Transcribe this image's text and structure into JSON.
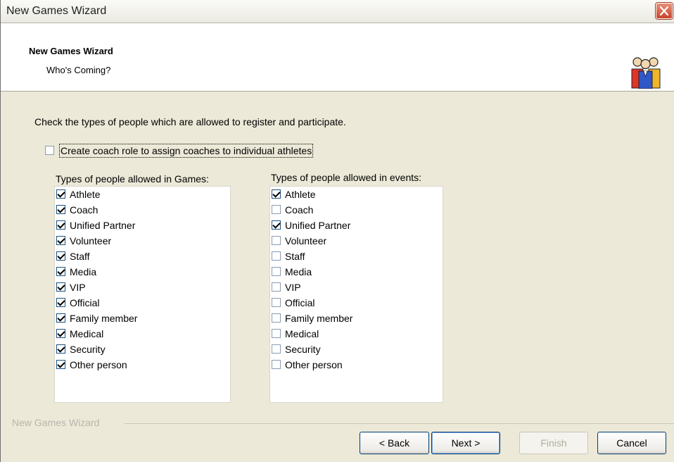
{
  "window": {
    "title": "New Games Wizard"
  },
  "header": {
    "title": "New Games Wizard",
    "subtitle": "Who's Coming?"
  },
  "instruction": "Check the types of people which are allowed to register and participate.",
  "coach_option": {
    "label": "Create coach role to assign coaches to individual athletes",
    "checked": false
  },
  "games_list": {
    "caption": "Types of people allowed in Games:",
    "items": [
      {
        "label": "Athlete",
        "checked": true
      },
      {
        "label": "Coach",
        "checked": true
      },
      {
        "label": "Unified Partner",
        "checked": true
      },
      {
        "label": "Volunteer",
        "checked": true
      },
      {
        "label": "Staff",
        "checked": true
      },
      {
        "label": "Media",
        "checked": true
      },
      {
        "label": "VIP",
        "checked": true
      },
      {
        "label": "Official",
        "checked": true
      },
      {
        "label": "Family member",
        "checked": true
      },
      {
        "label": "Medical",
        "checked": true
      },
      {
        "label": "Security",
        "checked": true
      },
      {
        "label": "Other person",
        "checked": true
      }
    ]
  },
  "events_list": {
    "caption": "Types of people allowed in events:",
    "items": [
      {
        "label": "Athlete",
        "checked": true
      },
      {
        "label": "Coach",
        "checked": false
      },
      {
        "label": "Unified Partner",
        "checked": true
      },
      {
        "label": "Volunteer",
        "checked": false
      },
      {
        "label": "Staff",
        "checked": false
      },
      {
        "label": "Media",
        "checked": false
      },
      {
        "label": "VIP",
        "checked": false
      },
      {
        "label": "Official",
        "checked": false
      },
      {
        "label": "Family member",
        "checked": false
      },
      {
        "label": "Medical",
        "checked": false
      },
      {
        "label": "Security",
        "checked": false
      },
      {
        "label": "Other person",
        "checked": false
      }
    ]
  },
  "footer": {
    "group_label": "New Games Wizard",
    "back_label": "< Back",
    "next_label": "Next >",
    "finish_label": "Finish",
    "cancel_label": "Cancel"
  },
  "icons": {
    "close": "close-icon",
    "header": "people-group-icon"
  }
}
